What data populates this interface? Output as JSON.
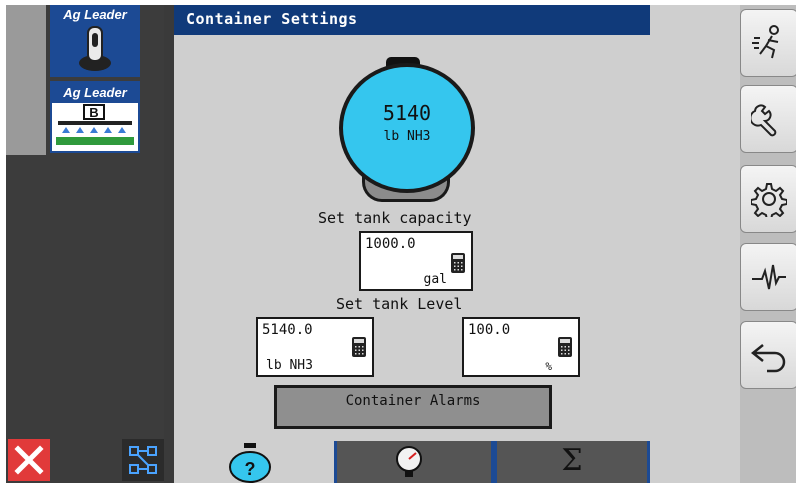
{
  "window": {
    "title": "Container Settings"
  },
  "left_panel": {
    "modules": [
      {
        "brand": "Ag Leader",
        "icon": "toggle-switch-icon"
      },
      {
        "brand": "Ag Leader",
        "letter": "B",
        "icon": "boom-sprayer-icon"
      }
    ],
    "buttons": [
      {
        "icon": "close-x-icon"
      },
      {
        "icon": "layout-map-icon"
      }
    ]
  },
  "tank": {
    "value": "5140",
    "unit": "lb NH3",
    "color": "#35c6ee"
  },
  "capacity": {
    "label": "Set tank capacity",
    "value": "1000.0",
    "unit": "gal"
  },
  "level": {
    "label": "Set tank Level",
    "amount": {
      "value": "5140.0",
      "unit": "lb NH3"
    },
    "percent": {
      "value": "100.0",
      "unit": "%"
    }
  },
  "alarms_button": {
    "label": "Container Alarms"
  },
  "tabs": [
    {
      "icon": "tank-question-icon",
      "badge": "?"
    },
    {
      "icon": "pressure-gauge-icon"
    },
    {
      "icon": "sigma-totals-icon",
      "symbol": "Σ"
    }
  ],
  "right_toolbar": [
    {
      "icon": "running-person-icon"
    },
    {
      "icon": "wrench-icon"
    },
    {
      "icon": "gear-icon"
    },
    {
      "icon": "diagnostics-pulse-icon"
    },
    {
      "icon": "back-arrow-icon"
    }
  ],
  "colors": {
    "title_bar": "#103a7a",
    "brand_blue": "#1c4a94",
    "close_red": "#e13a3a"
  }
}
